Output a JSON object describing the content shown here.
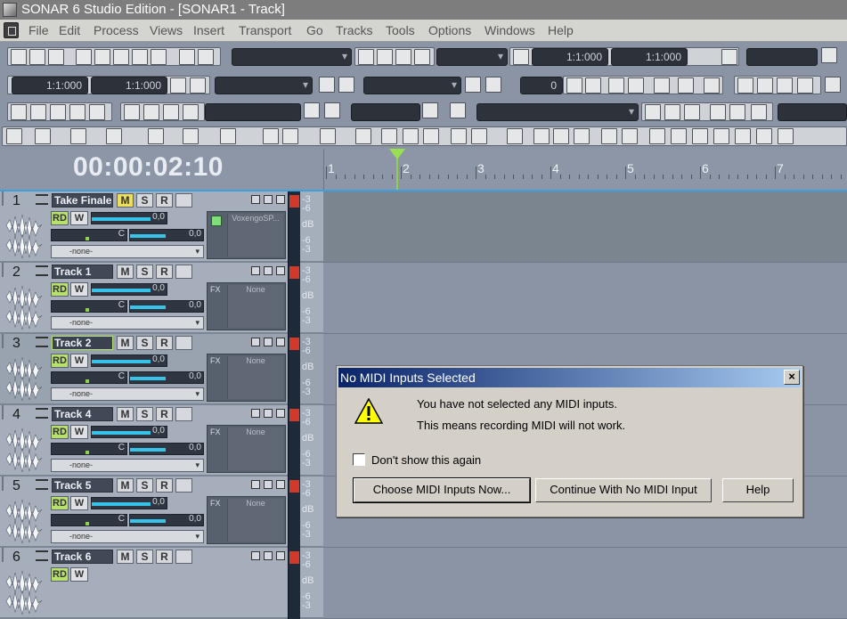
{
  "window": {
    "title": "SONAR 6 Studio Edition - [SONAR1 - Track]"
  },
  "menu": [
    "File",
    "Edit",
    "Process",
    "Views",
    "Insert",
    "Transport",
    "Go",
    "Tracks",
    "Tools",
    "Options",
    "Windows",
    "Help"
  ],
  "transport": {
    "time_display": "00:00:02:10",
    "now_a": "1:1:000",
    "now_b": "1:1:000",
    "loop_start": "1:1:000",
    "loop_end": "1:1:000",
    "counter": "0"
  },
  "ruler": {
    "marks": [
      "1",
      "2",
      "3",
      "4",
      "5",
      "6",
      "7"
    ],
    "playhead_measure": 2.0
  },
  "tracks": [
    {
      "num": "1",
      "name": "Take Finale",
      "vol": "0,0",
      "pan": "C",
      "aux": "0,0",
      "input": "-none-",
      "fx_label": "",
      "fx": "VoxengoSP...",
      "mute_on": true,
      "selected": false
    },
    {
      "num": "2",
      "name": "Track 1",
      "vol": "0,0",
      "pan": "C",
      "aux": "0,0",
      "input": "-none-",
      "fx_label": "FX",
      "fx": "None",
      "mute_on": false,
      "selected": false
    },
    {
      "num": "3",
      "name": "Track 2",
      "vol": "0,0",
      "pan": "C",
      "aux": "0,0",
      "input": "-none-",
      "fx_label": "FX",
      "fx": "None",
      "mute_on": false,
      "selected": true
    },
    {
      "num": "4",
      "name": "Track 4",
      "vol": "0,0",
      "pan": "C",
      "aux": "0,0",
      "input": "-none-",
      "fx_label": "FX",
      "fx": "None",
      "mute_on": false,
      "selected": false
    },
    {
      "num": "5",
      "name": "Track 5",
      "vol": "0,0",
      "pan": "C",
      "aux": "0,0",
      "input": "-none-",
      "fx_label": "FX",
      "fx": "None",
      "mute_on": false,
      "selected": false
    },
    {
      "num": "6",
      "name": "Track 6",
      "vol": "",
      "pan": "",
      "aux": "",
      "input": "",
      "fx_label": "",
      "fx": "",
      "mute_on": false,
      "selected": false
    }
  ],
  "buttons": {
    "mute": "M",
    "solo": "S",
    "rec": "R",
    "rd": "RD",
    "w": "W"
  },
  "meter": {
    "db_label": "dB",
    "top": "-3",
    "mid": "-6"
  },
  "dialog": {
    "title": "No MIDI Inputs Selected",
    "line1": "You have not selected any MIDI inputs.",
    "line2": "This means recording MIDI will not work.",
    "checkbox": "Don't show this again",
    "btn_choose": "Choose MIDI Inputs Now...",
    "btn_continue": "Continue With No MIDI Input",
    "btn_help": "Help",
    "close": "×"
  },
  "colors": {
    "accent": "#3aa0e0",
    "mute_on": "#ece05b",
    "rd_on": "#b7e06e",
    "playhead": "#99e050"
  }
}
